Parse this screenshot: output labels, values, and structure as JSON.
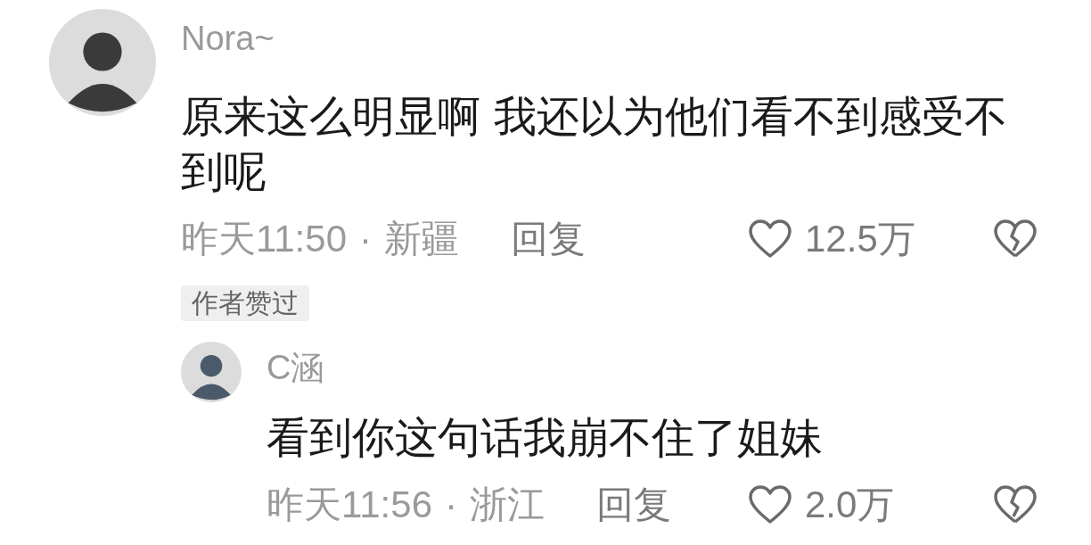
{
  "comments": [
    {
      "user": "Nora~",
      "text": "原来这么明显啊 我还以为他们看不到感受不到呢",
      "time": "昨天11:50",
      "separator": "·",
      "location": "新疆",
      "reply_label": "回复",
      "likes": "12.5万",
      "badge": "作者赞过",
      "children": [
        {
          "user": "C涵",
          "text": "看到你这句话我崩不住了姐妹",
          "time": "昨天11:56",
          "separator": "·",
          "location": "浙江",
          "reply_label": "回复",
          "likes": "2.0万"
        }
      ]
    }
  ]
}
